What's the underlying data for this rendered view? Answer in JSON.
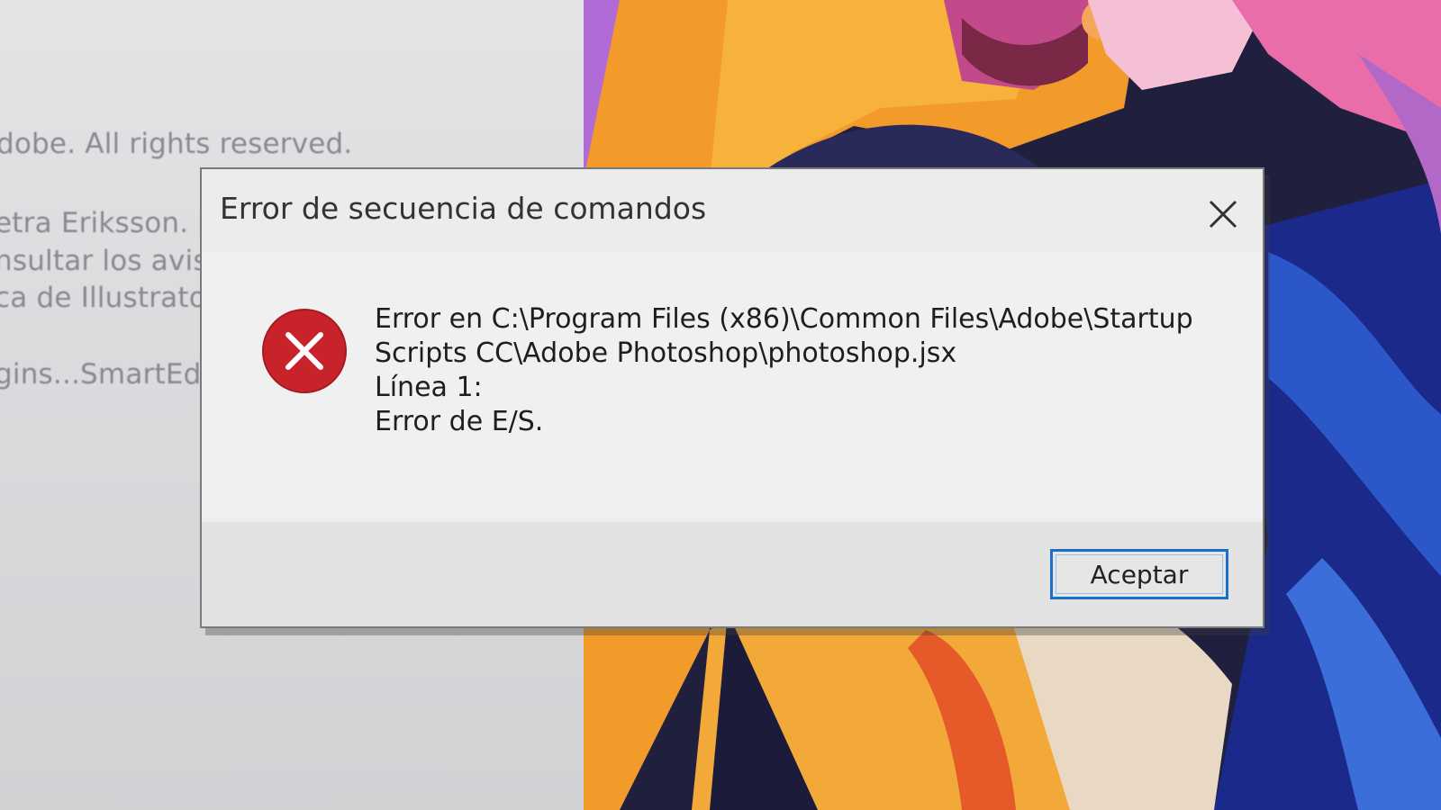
{
  "splash": {
    "lines": [
      "dobe. All rights reserved.",
      "etra Eriksson. F",
      "nsultar los avis",
      "ca de Illustrato",
      "gins...SmartEd"
    ]
  },
  "dialog": {
    "title": "Error de secuencia de comandos",
    "close_icon": "close-icon",
    "status_icon": "error-icon",
    "message_lines": [
      "Error en C:\\Program Files (x86)\\Common Files\\Adobe\\Startup",
      "Scripts CC\\Adobe Photoshop\\photoshop.jsx",
      "Línea 1:",
      "Error de E/S."
    ],
    "ok_label": "Aceptar"
  },
  "colors": {
    "error_red": "#c8232b",
    "accent_blue": "#1a6fc8",
    "dialog_bg": "#f0f0f0"
  }
}
